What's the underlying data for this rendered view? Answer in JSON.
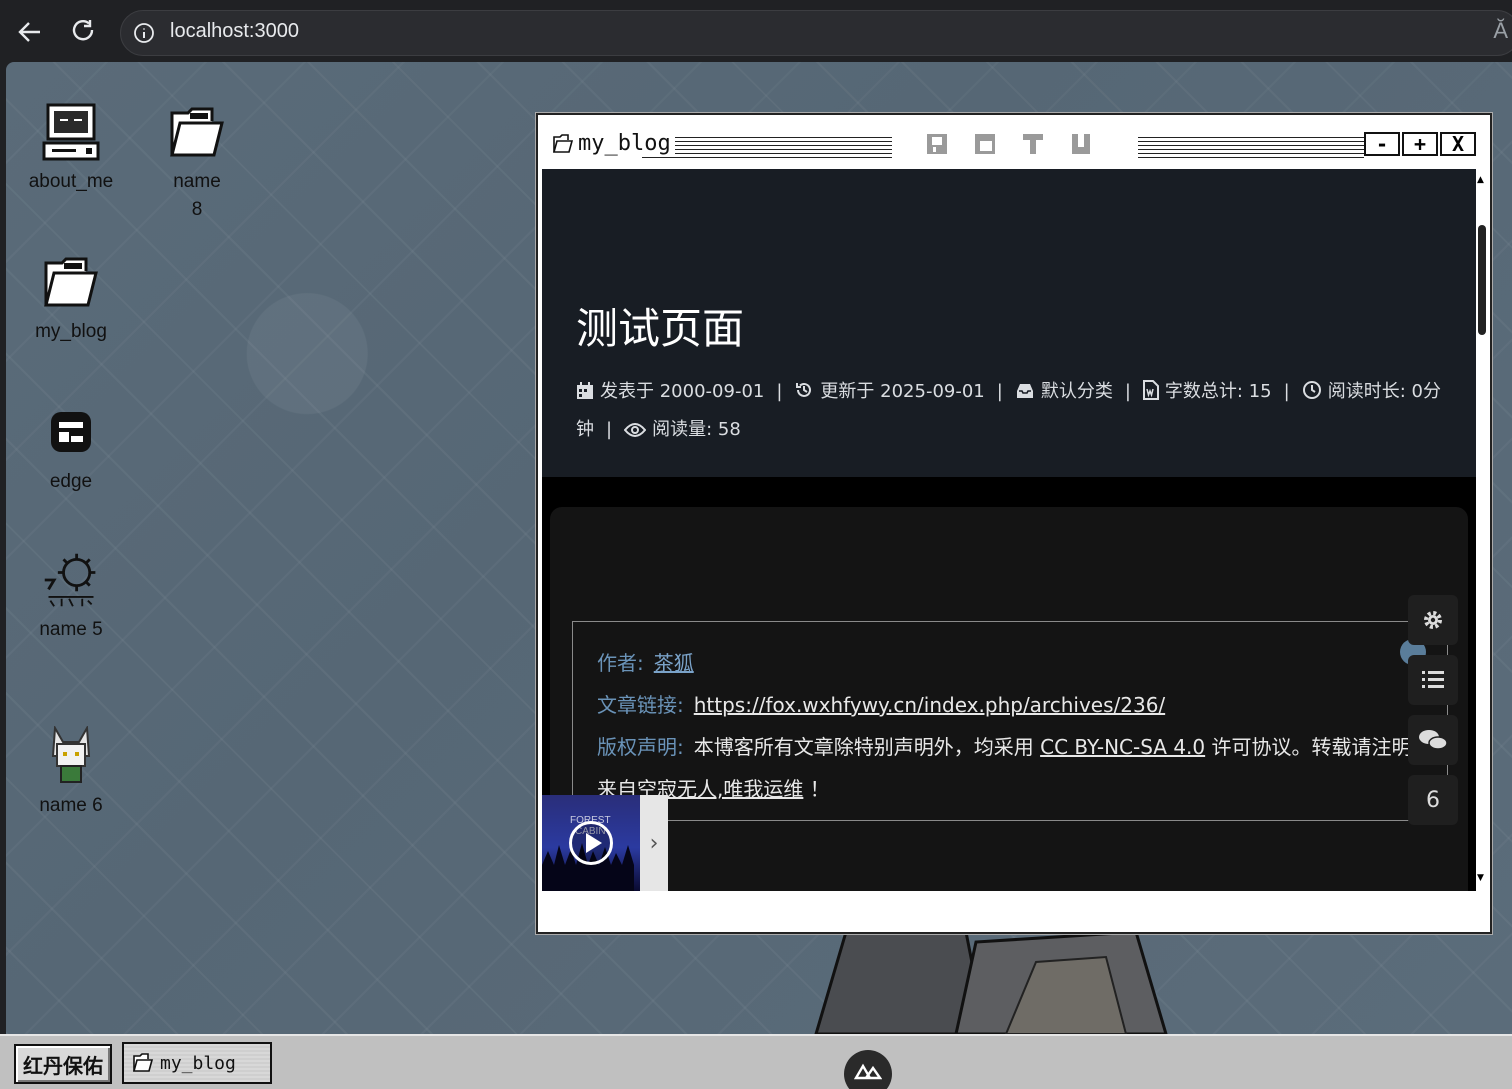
{
  "browser": {
    "url": "localhost:3000",
    "read_aloud": "Ă"
  },
  "desktop": {
    "icons": [
      {
        "label": "about_me"
      },
      {
        "label": "name\n8"
      },
      {
        "label": "my_blog"
      },
      {
        "label": "edge"
      },
      {
        "label": "name 5"
      },
      {
        "label": "name 6"
      }
    ]
  },
  "window": {
    "title": "my_blog",
    "controls": {
      "minimize": "-",
      "maximize": "+",
      "close": "X"
    }
  },
  "post": {
    "title": "测试页面",
    "meta": {
      "published_label": "发表于",
      "published": "2000-09-01",
      "updated_label": "更新于",
      "updated": "2025-09-01",
      "category": "默认分类",
      "wordcount_label": "字数总计:",
      "wordcount": "15",
      "readtime_label": "阅读时长:",
      "readtime": "0分钟",
      "views_label": "阅读量:",
      "views": "58",
      "separator": "|"
    },
    "copyright": {
      "author_label": "作者:",
      "author": "茶狐",
      "link_label": "文章链接:",
      "link": "https://fox.wxhfywy.cn/index.php/archives/236/",
      "license_label": "版权声明:",
      "license_prefix": "本博客所有文章除特别声明外，均采用",
      "license_name": "CC BY-NC-SA 4.0",
      "license_suffix": "许可协议。转载请注明来自",
      "site_name": "空寂无人,唯我运维",
      "end": "！"
    },
    "side_tools": {
      "comment_count": "6"
    },
    "player": {
      "art_text": "FOREST\nCABIN",
      "toggle": "›"
    }
  },
  "taskbar": {
    "start_label": "红丹保佑",
    "task_label": "my_blog"
  }
}
